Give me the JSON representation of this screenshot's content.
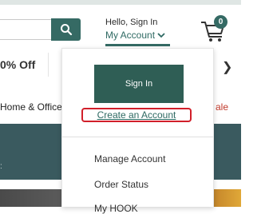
{
  "header": {
    "greeting": "Hello, Sign In",
    "account_label": "My Account",
    "cart_count": "0"
  },
  "promo": {
    "text": "0% Off"
  },
  "nav": {
    "home_office": "Home & Office",
    "sale": "ale"
  },
  "account_menu": {
    "sign_in": "Sign In",
    "create_account": "Create an Account",
    "items": [
      {
        "label": "Manage Account"
      },
      {
        "label": "Order Status"
      },
      {
        "label": "My HOOK"
      }
    ]
  },
  "colors": {
    "brand_green": "#356a64",
    "highlight_red": "#d11f2a",
    "sale_red": "#c0392b"
  }
}
